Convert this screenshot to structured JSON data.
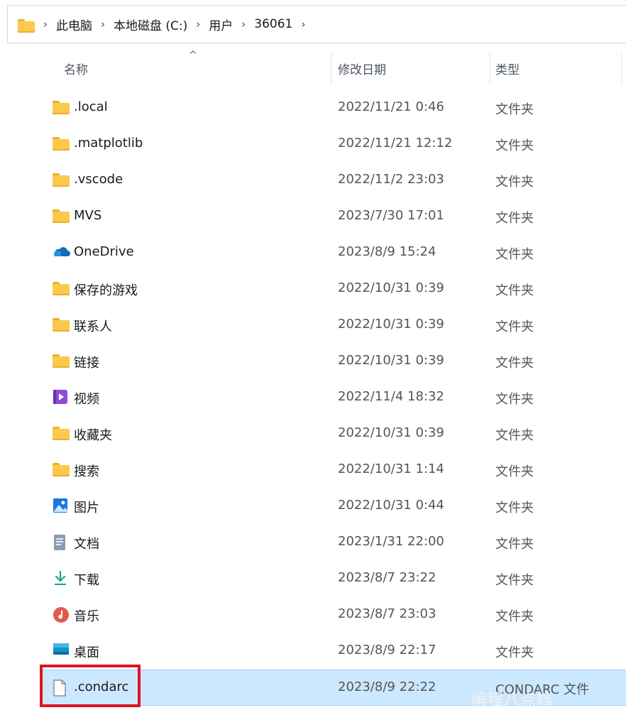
{
  "breadcrumb": [
    "此电脑",
    "本地磁盘 (C:)",
    "用户",
    "36061"
  ],
  "columns": {
    "name": "名称",
    "date": "修改日期",
    "type": "类型"
  },
  "rows": [
    {
      "name": ".local",
      "date": "2022/11/21 0:46",
      "type": "文件夹",
      "icon": "folder-icon"
    },
    {
      "name": ".matplotlib",
      "date": "2022/11/21 12:12",
      "type": "文件夹",
      "icon": "folder-icon"
    },
    {
      "name": ".vscode",
      "date": "2022/11/2 23:03",
      "type": "文件夹",
      "icon": "folder-icon"
    },
    {
      "name": "MVS",
      "date": "2023/7/30 17:01",
      "type": "文件夹",
      "icon": "folder-icon"
    },
    {
      "name": "OneDrive",
      "date": "2023/8/9 15:24",
      "type": "文件夹",
      "icon": "onedrive-cloud-icon"
    },
    {
      "name": "保存的游戏",
      "date": "2022/10/31 0:39",
      "type": "文件夹",
      "icon": "folder-icon"
    },
    {
      "name": "联系人",
      "date": "2022/10/31 0:39",
      "type": "文件夹",
      "icon": "folder-icon"
    },
    {
      "name": "链接",
      "date": "2022/10/31 0:39",
      "type": "文件夹",
      "icon": "folder-icon"
    },
    {
      "name": "视频",
      "date": "2022/11/4 18:32",
      "type": "文件夹",
      "icon": "video-icon"
    },
    {
      "name": "收藏夹",
      "date": "2022/10/31 0:39",
      "type": "文件夹",
      "icon": "folder-icon"
    },
    {
      "name": "搜索",
      "date": "2022/10/31 1:14",
      "type": "文件夹",
      "icon": "folder-icon"
    },
    {
      "name": "图片",
      "date": "2022/10/31 0:44",
      "type": "文件夹",
      "icon": "picture-icon"
    },
    {
      "name": "文档",
      "date": "2023/1/31 22:00",
      "type": "文件夹",
      "icon": "document-icon"
    },
    {
      "name": "下载",
      "date": "2023/8/7 23:22",
      "type": "文件夹",
      "icon": "download-icon"
    },
    {
      "name": "音乐",
      "date": "2023/8/7 23:03",
      "type": "文件夹",
      "icon": "music-icon"
    },
    {
      "name": "桌面",
      "date": "2023/8/9 22:17",
      "type": "文件夹",
      "icon": "desktop-icon"
    },
    {
      "name": ".condarc",
      "date": "2023/8/9 22:22",
      "type": "CONDARC 文件",
      "icon": "file-icon",
      "selected": true
    }
  ],
  "watermark": "编程八点档",
  "colors": {
    "folder": "#fcc94b",
    "selection": "#cce8ff",
    "highlight_box": "#e0141e"
  }
}
